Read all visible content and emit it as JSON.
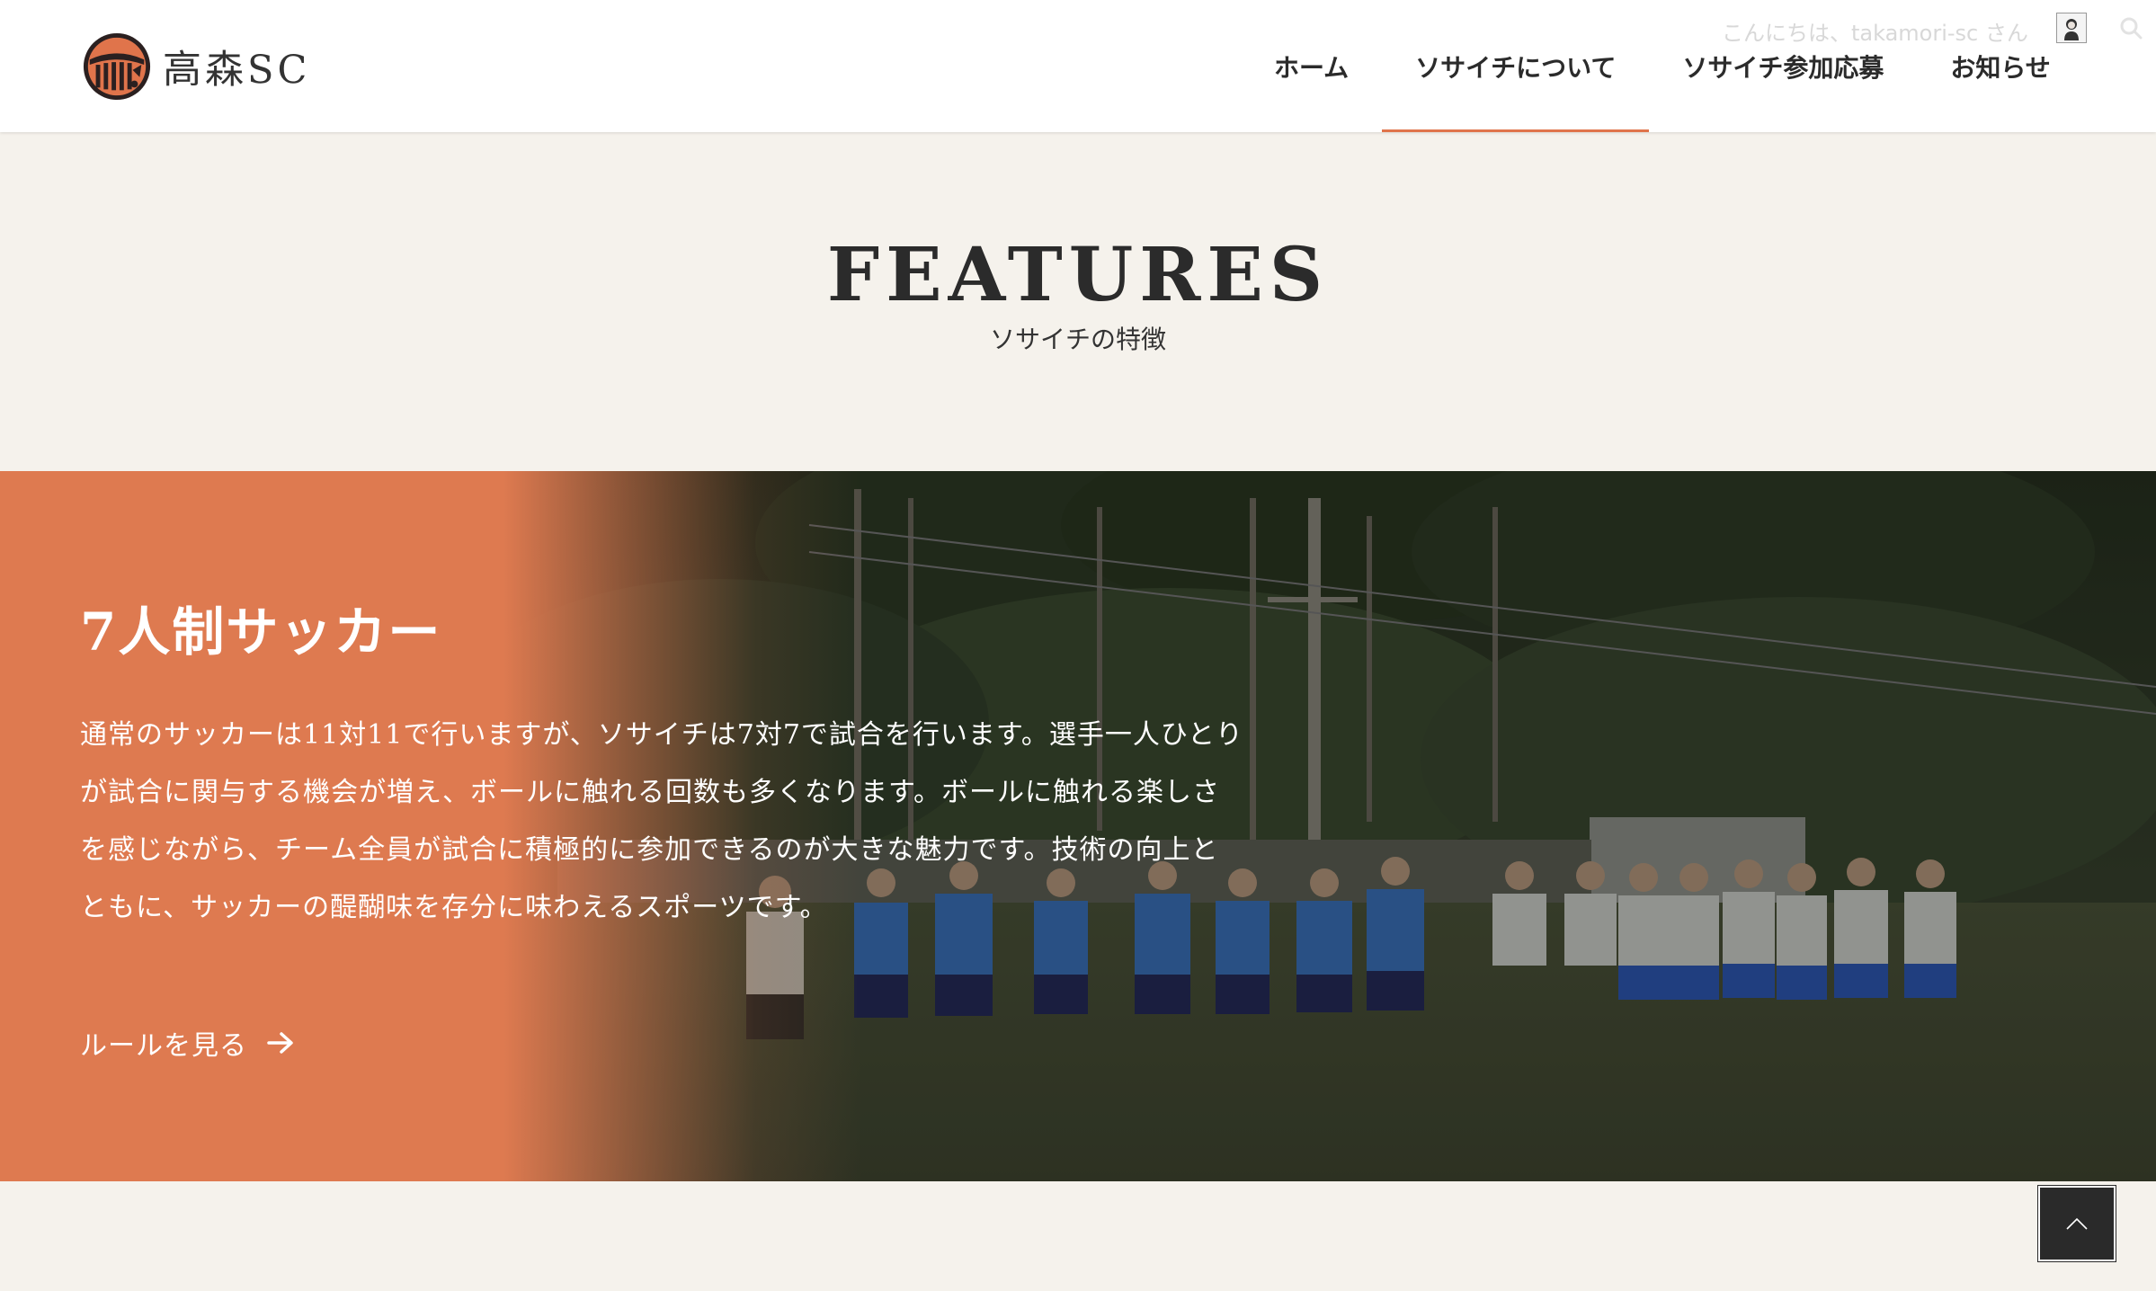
{
  "site": {
    "logo_text": "高森SC",
    "greeting": "こんにちは、takamori-sc さん"
  },
  "nav": {
    "items": [
      {
        "label": "ホーム"
      },
      {
        "label": "ソサイチについて"
      },
      {
        "label": "ソサイチ参加応募"
      },
      {
        "label": "お知らせ"
      }
    ],
    "active_index": 1
  },
  "section": {
    "title": "FEATURES",
    "subtitle": "ソサイチの特徴"
  },
  "feature": {
    "heading": "7人制サッカー",
    "body_lines": [
      "通常のサッカーは11対11で行いますが、ソサイチは7対7で試合を行います。選手一人ひとり",
      "が試合に関与する機会が増え、ボールに触れる回数も多くなります。ボールに触れる楽しさ",
      "を感じながら、チーム全員が試合に積極的に参加できるのが大きな魅力です。技術の向上と",
      "ともに、サッカーの醍醐味を存分に味わえるスポーツです。"
    ],
    "link_label": "ルールを見る"
  },
  "icons": {
    "logo": "team-crest-icon",
    "avatar": "user-avatar-icon",
    "search": "search-icon",
    "link_arrow": "arrow-right-icon",
    "to_top": "chevron-up-icon"
  },
  "colors": {
    "accent": "#e0744b",
    "page_bg": "#f5f2ec",
    "header_bg": "#ffffff",
    "to_top_bg": "#2a2a2a"
  }
}
